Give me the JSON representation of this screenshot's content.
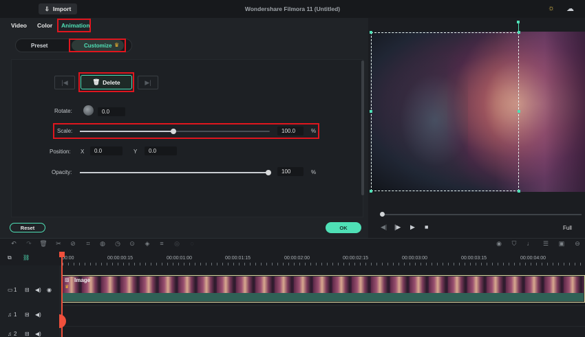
{
  "app": {
    "title": "Wondershare Filmora 11 (Untitled)",
    "import_label": "Import"
  },
  "panel": {
    "tabs": [
      "Video",
      "Color",
      "Animation"
    ],
    "active_tab": "Animation",
    "segments": [
      "Preset",
      "Customize"
    ],
    "active_segment": "Customize",
    "crown_icon": "crown-icon"
  },
  "keyframe": {
    "delete_label": "Delete",
    "prev_icon": "prev-keyframe-icon",
    "next_icon": "next-keyframe-icon"
  },
  "properties": {
    "rotate": {
      "label": "Rotate:",
      "value": "0.0"
    },
    "scale": {
      "label": "Scale:",
      "value": "100.0",
      "unit": "%",
      "level": 0.5
    },
    "position": {
      "label": "Position:",
      "x_label": "X",
      "x_value": "0.0",
      "y_label": "Y",
      "y_value": "0.0"
    },
    "opacity": {
      "label": "Opacity:",
      "value": "100",
      "unit": "%",
      "level": 1.0
    }
  },
  "buttons": {
    "reset": "Reset",
    "ok": "OK"
  },
  "player": {
    "full_label": "Full",
    "progress": 0.0
  },
  "timeline": {
    "ruler_ticks": [
      "00:00",
      "00:00:00:15",
      "00:00:01:00",
      "00:00:01:15",
      "00:00:02:00",
      "00:00:02:15",
      "00:00:03:00",
      "00:00:03:15",
      "00:00:04:00"
    ],
    "clip_label": "Image",
    "tracks": [
      {
        "label": "1",
        "type": "video"
      },
      {
        "label": "1",
        "type": "audio"
      },
      {
        "label": "2",
        "type": "audio"
      }
    ]
  },
  "colors": {
    "accent": "#4fe0b6",
    "highlight": "#e0161e",
    "playhead": "#f0503c"
  }
}
